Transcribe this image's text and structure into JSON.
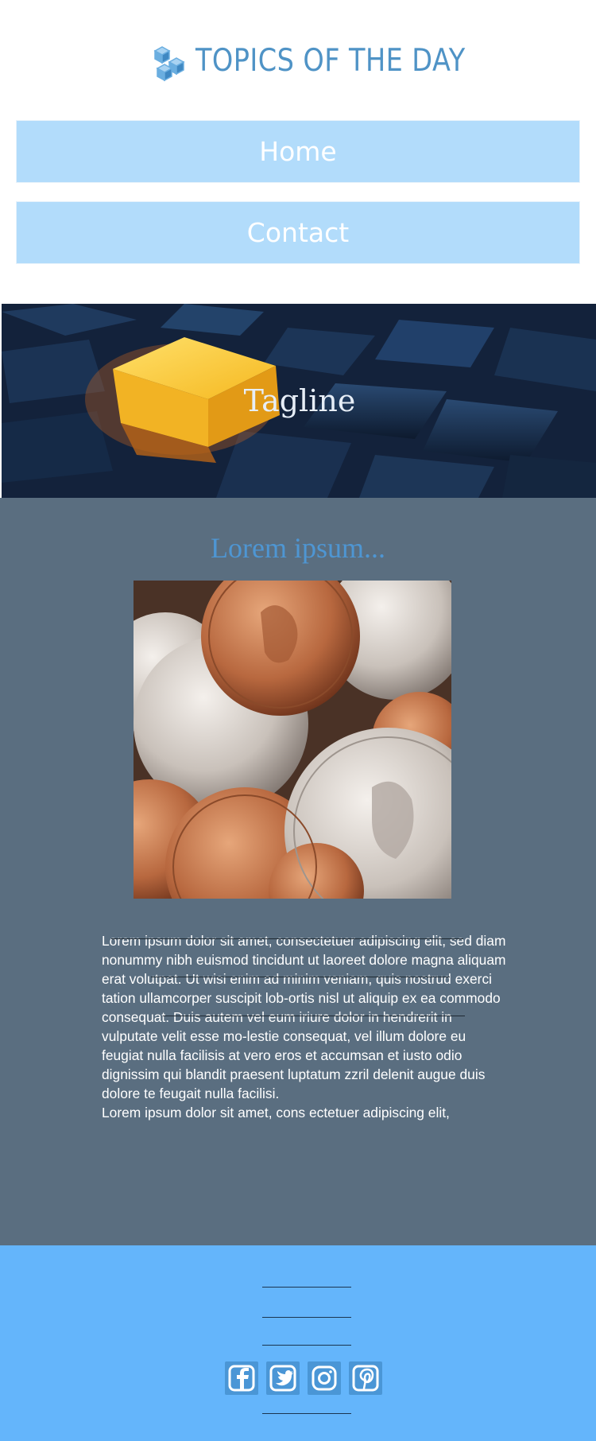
{
  "header": {
    "logo_text": "TOPICS OF THE DAY",
    "nav": [
      {
        "label": "Home"
      },
      {
        "label": "Contact"
      }
    ]
  },
  "hero": {
    "tagline": "Tagline"
  },
  "content": {
    "title": "Lorem ipsum...",
    "paragraphs": [
      "Lorem ipsum dolor sit amet, consectetuer adipiscing elit, sed diam nonummy nibh euismod tincidunt ut laoreet dolore magna aliquam erat volutpat. Ut wisi enim ad minim veniam, quis nostrud exerci tation ullamcorper suscipit lob-ortis nisl ut aliquip ex ea commodo consequat. Duis autem vel eum iriure dolor in hendrerit in vulputate velit esse mo-lestie consequat, vel illum dolore eu feugiat nulla facilisis at vero eros et accumsan et iusto odio dignissim qui blandit praesent luptatum zzril delenit augue duis dolore te feugait nulla facilisi.",
      "Lorem ipsum dolor sit amet, cons ectetuer adipiscing elit,"
    ]
  },
  "footer": {
    "social": [
      {
        "icon": "facebook-icon"
      },
      {
        "icon": "twitter-icon"
      },
      {
        "icon": "instagram-icon"
      },
      {
        "icon": "pinterest-icon"
      }
    ]
  },
  "colors": {
    "brand_blue": "#4f93c6",
    "nav_button": "#b2dcfb",
    "content_bg": "#5a6e80",
    "content_title": "#4e96d3",
    "footer_bg": "#64b5fb",
    "social_tile": "#4a96d6"
  }
}
